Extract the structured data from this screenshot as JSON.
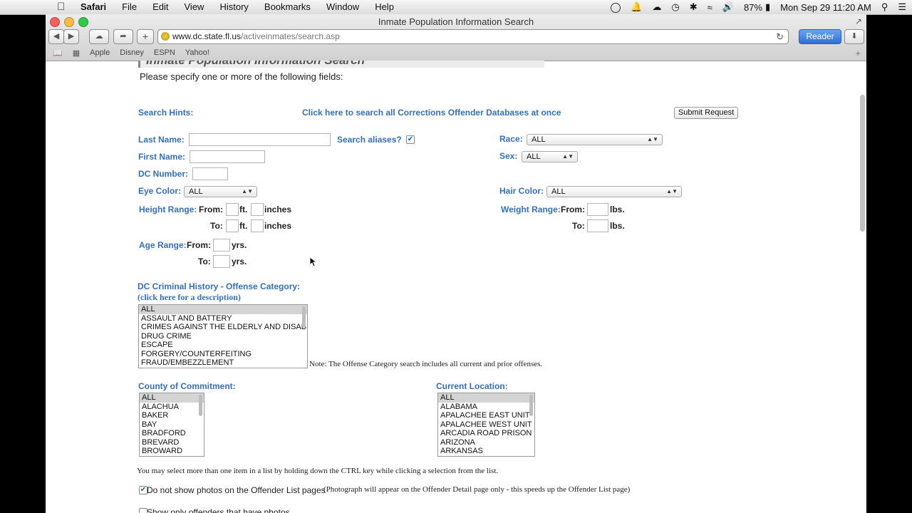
{
  "menubar": {
    "app_name": "Safari",
    "items": [
      "File",
      "Edit",
      "View",
      "History",
      "Bookmarks",
      "Window",
      "Help"
    ],
    "battery": "87%",
    "clock": "Mon Sep 29  11:20 AM"
  },
  "window": {
    "title": "Inmate Population Information Search",
    "url_domain": "www.dc.state.fl.us",
    "url_path": "/activeinmates/search.asp",
    "reader_label": "Reader",
    "bookmarks": [
      "Apple",
      "Disney",
      "ESPN",
      "Yahoo!"
    ]
  },
  "page": {
    "heading_partial": "Inmate Population Information Search",
    "intro": "Please specify one or more of the following fields:",
    "search_hints": "Search Hints:",
    "all_db_link": "Click here to search all Corrections Offender Databases at once",
    "submit_label": "Submit Request",
    "last_name_label": "Last Name:",
    "search_aliases_label": "Search aliases?",
    "race_label": "Race:",
    "race_value": "ALL",
    "first_name_label": "First Name:",
    "sex_label": "Sex:",
    "sex_value": "ALL",
    "dc_number_label": "DC Number:",
    "eye_color_label": "Eye Color:",
    "eye_color_value": "ALL",
    "hair_color_label": "Hair Color:",
    "hair_color_value": "ALL",
    "height_range_label": "Height Range:",
    "weight_range_label": "Weight Range:",
    "from_label": "From:",
    "to_label": "To:",
    "ft_label": "ft.",
    "inches_label": "inches",
    "lbs_label": "lbs.",
    "age_range_label": "Age Range:",
    "yrs_label": "yrs.",
    "offense_label": "DC Criminal History - Offense Category:",
    "offense_desc_link": "(click here for a description)",
    "offense_options": [
      "ALL",
      "ASSAULT AND BATTERY",
      "CRIMES AGAINST THE ELDERLY AND DISABLED",
      "DRUG CRIME",
      "ESCAPE",
      "FORGERY/COUNTERFEITING",
      "FRAUD/EMBEZZLEMENT"
    ],
    "offense_note": "Note: The Offense Category search includes all current and prior offenses.",
    "county_label": "County of Commitment:",
    "county_options": [
      "ALL",
      "ALACHUA",
      "BAKER",
      "BAY",
      "BRADFORD",
      "BREVARD",
      "BROWARD"
    ],
    "location_label": "Current Location:",
    "location_options": [
      "ALL",
      "ALABAMA",
      "APALACHEE EAST UNIT",
      "APALACHEE WEST UNIT",
      "ARCADIA ROAD PRISON",
      "ARIZONA",
      "ARKANSAS"
    ],
    "multi_select_note": "You may select more than one item in a list by holding down the CTRL key while clicking a selection from the list.",
    "no_photos_label": "Do not show photos on the Offender List pages",
    "no_photos_note": "(Photograph will appear on the Offender Detail page only - this speeds up the Offender List page)",
    "only_photos_partial": "Show only offenders that have photos"
  }
}
